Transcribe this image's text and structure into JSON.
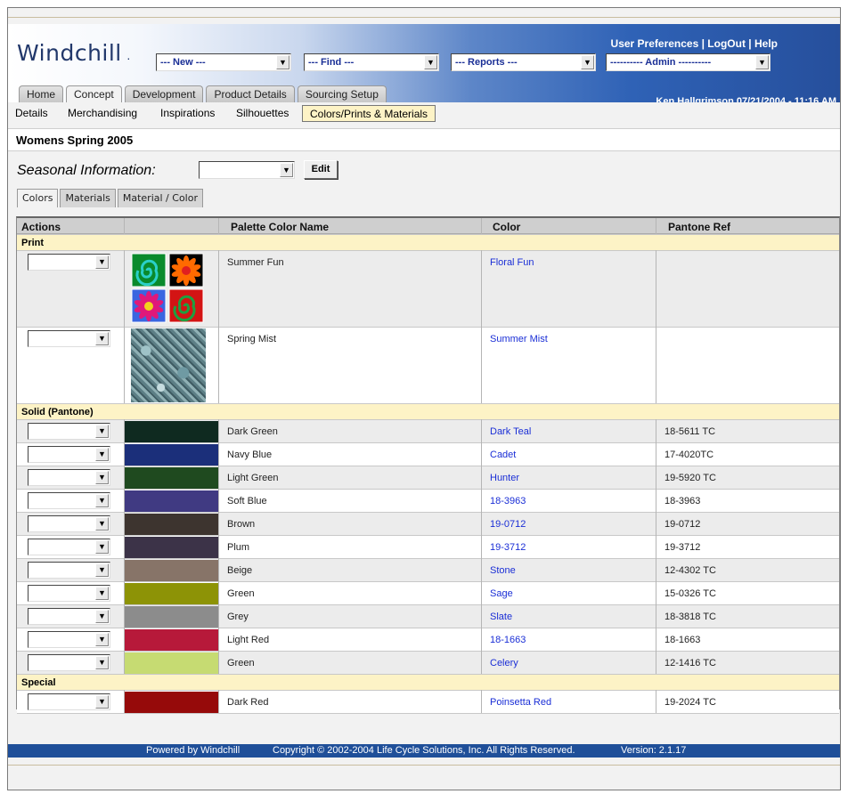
{
  "app": {
    "logo": "Windchill"
  },
  "menus": {
    "new": "--- New ---",
    "find": "--- Find ---",
    "reports": "--- Reports ---",
    "admin": "---------- Admin ----------"
  },
  "header": {
    "user_preferences": "User Preferences",
    "logout": "LogOut",
    "help": "Help",
    "separator": " | ",
    "user_line": "Ken Hallgrimson  07/21/2004 - 11:16 AM"
  },
  "tabs": [
    "Home",
    "Concept",
    "Development",
    "Product Details",
    "Sourcing Setup"
  ],
  "active_tab": "Concept",
  "subnav": {
    "items": [
      "Details",
      "Merchandising",
      "Inspirations",
      "Silhouettes"
    ],
    "active": "Colors/Prints & Materials"
  },
  "page_title": "Womens Spring 2005",
  "seasonal": {
    "label": "Seasonal Information:",
    "selected": "",
    "edit_label": "Edit"
  },
  "subtabs": [
    "Colors",
    "Materials",
    "Material / Color"
  ],
  "table": {
    "headers": [
      "Actions",
      "",
      "Palette Color Name",
      "Color",
      "Pantone Ref"
    ],
    "sections": [
      {
        "name": "Print",
        "rows": [
          {
            "name": "Summer Fun",
            "color": "Floral Fun",
            "pantone": "",
            "swatch": "print-floral"
          },
          {
            "name": "Spring Mist",
            "color": "Summer Mist",
            "pantone": "",
            "swatch": "print-mist"
          }
        ]
      },
      {
        "name": "Solid (Pantone)",
        "rows": [
          {
            "name": "Dark Green",
            "color": "Dark Teal",
            "pantone": "18-5611 TC",
            "hex": "#0f2a20"
          },
          {
            "name": "Navy Blue",
            "color": "Cadet",
            "pantone": "17-4020TC",
            "hex": "#1b2f7a"
          },
          {
            "name": "Light Green",
            "color": "Hunter",
            "pantone": "19-5920 TC",
            "hex": "#1f4a1f"
          },
          {
            "name": "Soft Blue",
            "color": "18-3963",
            "pantone": "18-3963",
            "hex": "#403a82"
          },
          {
            "name": "Brown",
            "color": "19-0712",
            "pantone": "19-0712",
            "hex": "#3d342f"
          },
          {
            "name": "Plum",
            "color": "19-3712",
            "pantone": "19-3712",
            "hex": "#3c3348"
          },
          {
            "name": "Beige",
            "color": "Stone",
            "pantone": "12-4302 TC",
            "hex": "#877468"
          },
          {
            "name": "Green",
            "color": "Sage",
            "pantone": "15-0326 TC",
            "hex": "#8d9306"
          },
          {
            "name": "Grey",
            "color": "Slate",
            "pantone": "18-3818 TC",
            "hex": "#8c8c8c"
          },
          {
            "name": "Light Red",
            "color": "18-1663",
            "pantone": "18-1663",
            "hex": "#b7193a"
          },
          {
            "name": "Green",
            "color": "Celery",
            "pantone": "12-1416 TC",
            "hex": "#c6db72"
          }
        ]
      },
      {
        "name": "Special",
        "rows": [
          {
            "name": "Dark Red",
            "color": "Poinsetta Red",
            "pantone": "19-2024 TC",
            "hex": "#960a0a"
          }
        ]
      }
    ]
  },
  "footer": {
    "powered": "Powered by Windchill",
    "copyright": "Copyright © 2002-2004 Life Cycle Solutions, Inc. All Rights Reserved.",
    "version": "Version: 2.1.17"
  }
}
